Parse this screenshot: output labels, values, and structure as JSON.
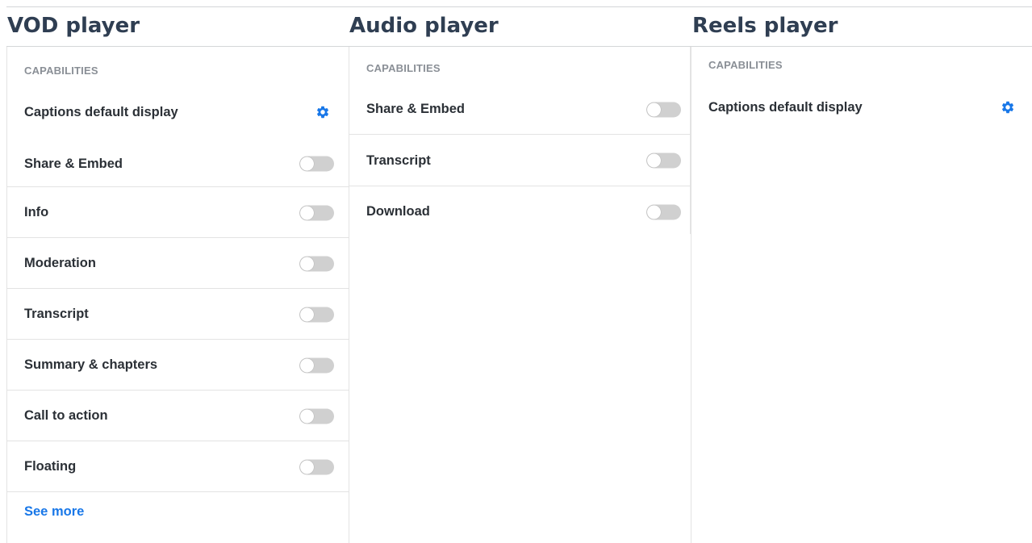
{
  "vod": {
    "title": "VOD player",
    "section": "CAPABILITIES",
    "captions_label": "Captions default display",
    "items": [
      {
        "label": "Share & Embed",
        "enabled": false
      },
      {
        "label": "Info",
        "enabled": false
      },
      {
        "label": "Moderation",
        "enabled": false
      },
      {
        "label": "Transcript",
        "enabled": false
      },
      {
        "label": "Summary & chapters",
        "enabled": false
      },
      {
        "label": "Call to action",
        "enabled": false
      },
      {
        "label": "Floating",
        "enabled": false
      }
    ],
    "see_more": "See more"
  },
  "audio": {
    "title": "Audio player",
    "section": "CAPABILITIES",
    "items": [
      {
        "label": "Share & Embed",
        "enabled": false
      },
      {
        "label": "Transcript",
        "enabled": false
      },
      {
        "label": "Download",
        "enabled": false
      }
    ]
  },
  "reels": {
    "title": "Reels player",
    "section": "CAPABILITIES",
    "captions_label": "Captions default display"
  },
  "colors": {
    "accent": "#1877e8",
    "heading": "#2f3e52",
    "toggle_off": "#d0d0d0",
    "divider": "#e3e3e3"
  },
  "icons": {
    "settings": "gear-icon"
  }
}
